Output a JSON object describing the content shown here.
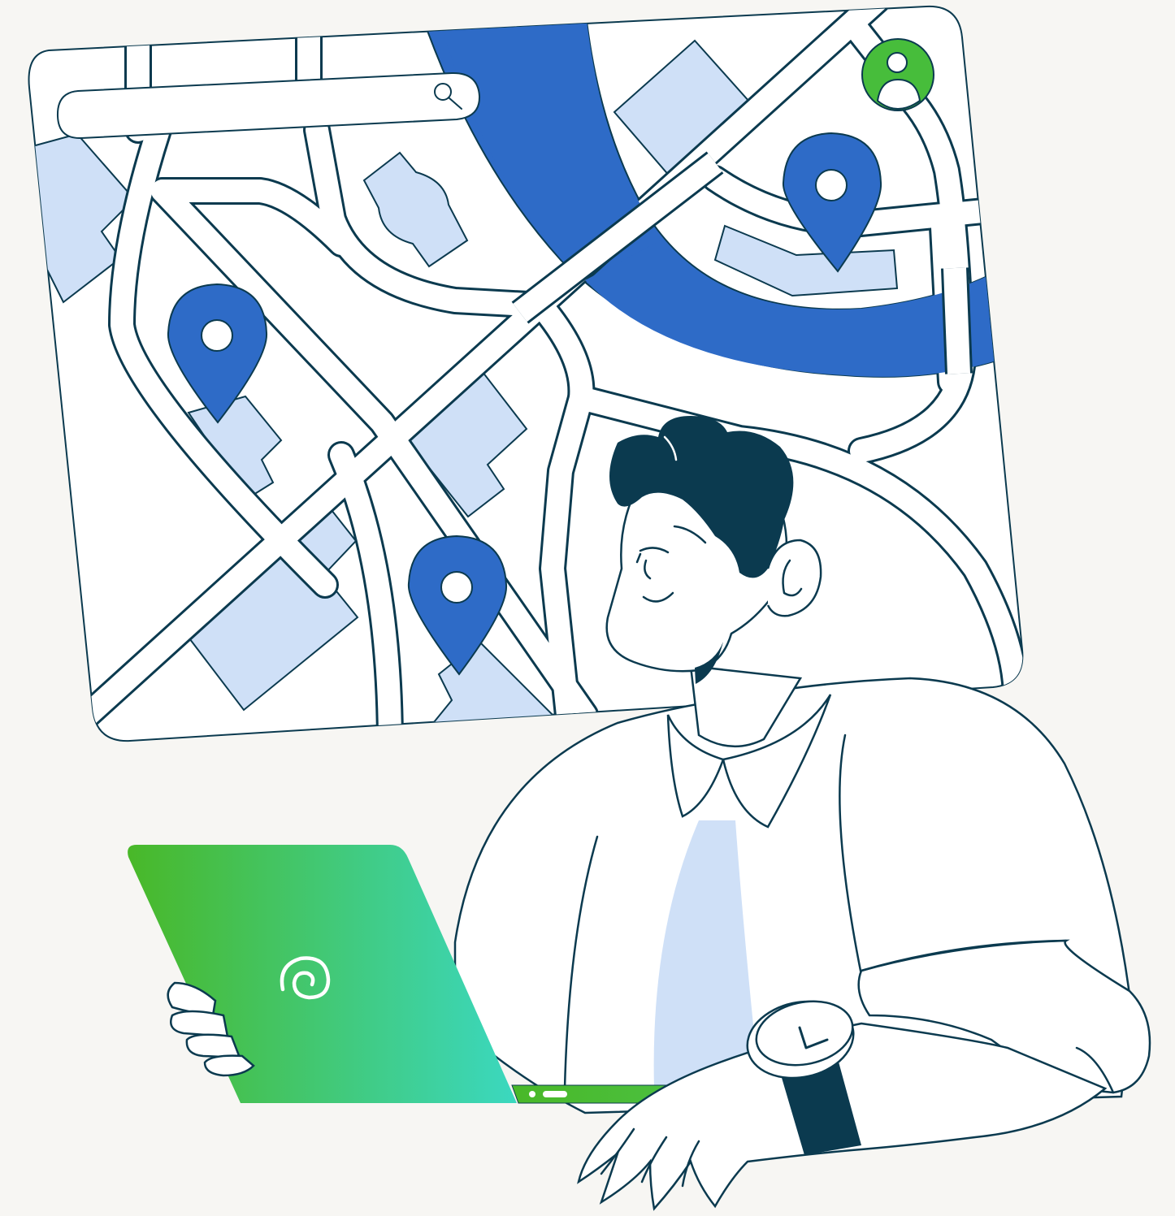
{
  "illustration": {
    "subject": "person-with-laptop-viewing-map",
    "colors": {
      "background": "#f7f6f3",
      "outline": "#0b3a4f",
      "river": "#2e6bc7",
      "buildings": "#cfe0f7",
      "pin": "#2e6bc7",
      "avatar_marker": "#47bd3b",
      "laptop_gradient_start": "#49b828",
      "laptop_gradient_end": "#3bd8c0",
      "hair": "#0b3a4f",
      "tie": "#cfe0f7",
      "shirt": "#ffffff"
    }
  },
  "map": {
    "search_bar": {
      "value": "",
      "icon": "search-icon"
    },
    "pins": [
      {
        "icon": "location-pin-icon"
      },
      {
        "icon": "location-pin-icon"
      },
      {
        "icon": "location-pin-icon"
      }
    ],
    "user_marker": {
      "icon": "user-location-icon"
    }
  },
  "laptop": {
    "logo": "spiral-logo-icon"
  }
}
